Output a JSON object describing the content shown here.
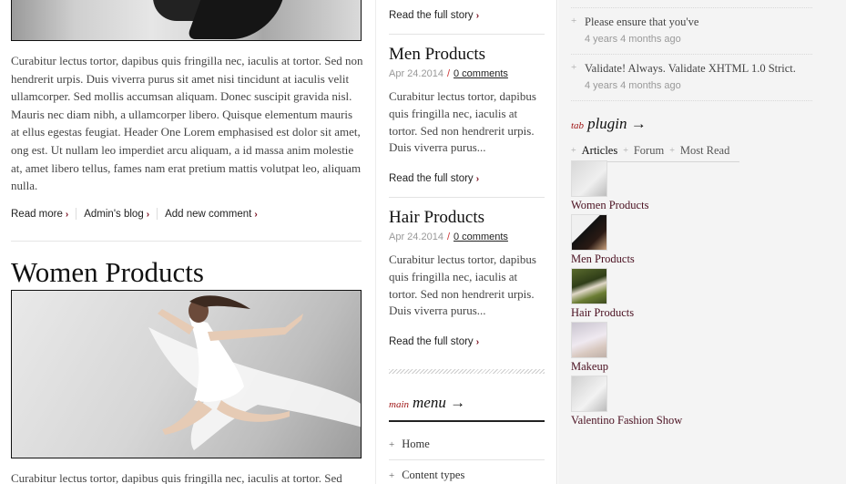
{
  "left": {
    "paragraph1": "Curabitur lectus tortor, dapibus quis fringilla nec, iaculis at tortor. Sed non hendrerit urpis. Duis viverra purus sit amet nisi tincidunt at iaculis velit ullamcorper. Sed mollis accumsan aliquam. Donec suscipit gravida nisl. Mauris nec diam nibh, a ullamcorper libero. Quisque elementum mauris at ellus egestas feugiat. Header One Lorem emphasised est dolor sit amet, ong est. Ut nullam leo imperdiet arcu aliquam, a id massa anim molestie at, amet libero tellus, fames nam erat pretium mattis volutpat leo, aliquam nulla.",
    "links": {
      "read_more": "Read more",
      "admin_blog": "Admin's blog",
      "add_comment": "Add new comment"
    },
    "post_title": "Women Products",
    "paragraph2": "Curabitur lectus tortor, dapibus quis fringilla nec, iaculis at tortor. Sed"
  },
  "middle": {
    "top_read": "Read the full story",
    "posts": [
      {
        "title": "Men Products",
        "date": "Apr 24.2014",
        "comments": "0 comments",
        "text": "Curabitur lectus tortor, dapibus quis fringilla nec, iaculis at tortor. Sed non hendrerit urpis. Duis viverra purus...",
        "read": "Read the full story"
      },
      {
        "title": "Hair Products",
        "date": "Apr 24.2014",
        "comments": "0 comments",
        "text": "Curabitur lectus tortor, dapibus quis fringilla nec, iaculis at tortor. Sed non hendrerit urpis. Duis viverra purus...",
        "read": "Read the full story"
      }
    ],
    "menu_small": "main",
    "menu_big": "menu →",
    "menu_items": [
      "Home",
      "Content types"
    ]
  },
  "right": {
    "recent": [
      {
        "text": "Please ensure that you've",
        "time": "4 years 4 months ago"
      },
      {
        "text": "Validate! Always. Validate XHTML 1.0 Strict.",
        "time": "4 years 4 months ago"
      }
    ],
    "plugin_small": "tab",
    "plugin_big": "plugin →",
    "tabs": [
      "Articles",
      "Forum",
      "Most Read"
    ],
    "articles": [
      "Women Products",
      "Men Products",
      "Hair Products",
      "Makeup",
      "Valentino Fashion Show"
    ]
  },
  "colors": {
    "accent": "#a01818",
    "link": "#4a1020",
    "chevron": "#7a1020"
  }
}
